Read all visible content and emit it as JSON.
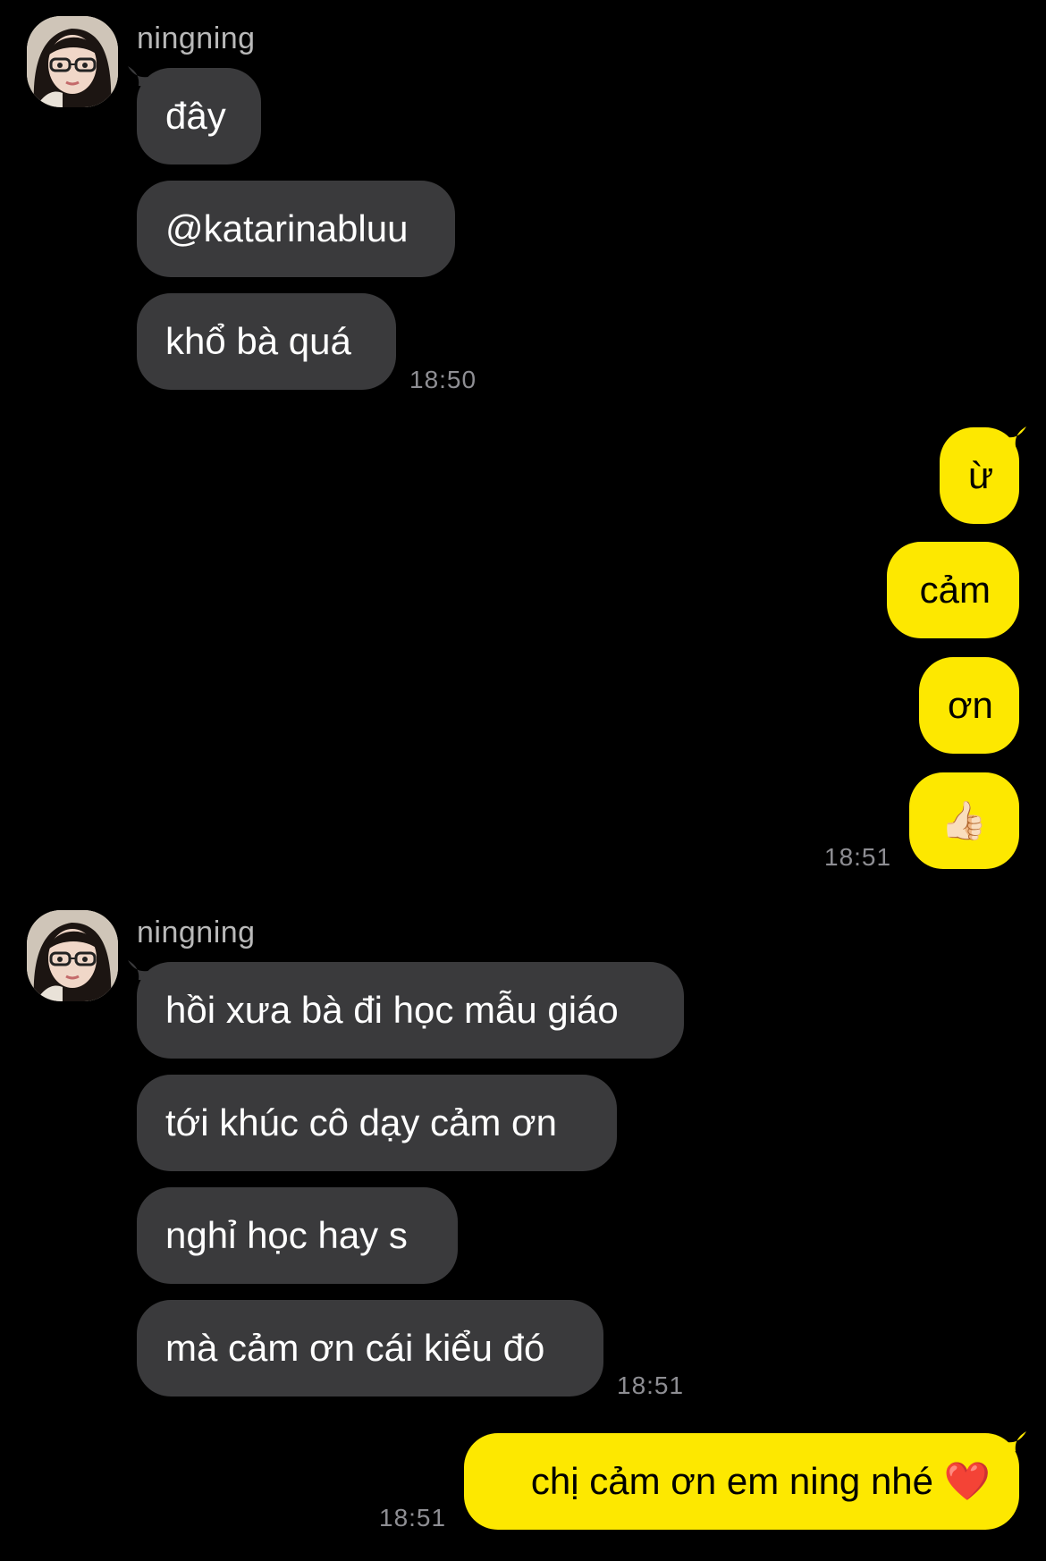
{
  "colors": {
    "background": "#000000",
    "incoming_bubble": "#3a3a3c",
    "outgoing_bubble": "#fde800",
    "name_text": "#b9b9b9",
    "time_text": "#8e8e93"
  },
  "groups": [
    {
      "direction": "incoming",
      "sender": "ningning",
      "avatar_icon": "profile-photo",
      "messages": [
        "đây",
        "@katarinabluu",
        "khổ bà quá"
      ],
      "time": "18:50"
    },
    {
      "direction": "outgoing",
      "messages": [
        "ừ",
        "cảm",
        "ơn",
        "👍🏻"
      ],
      "time": "18:51"
    },
    {
      "direction": "incoming",
      "sender": "ningning",
      "avatar_icon": "profile-photo",
      "messages": [
        "hồi xưa bà đi học mẫu giáo",
        "tới khúc cô dạy cảm ơn",
        "nghỉ học hay s",
        "mà cảm ơn cái kiểu đó"
      ],
      "time": "18:51"
    },
    {
      "direction": "outgoing",
      "messages": [
        "chị cảm ơn em ning nhé ❤️"
      ],
      "time": "18:51"
    }
  ]
}
